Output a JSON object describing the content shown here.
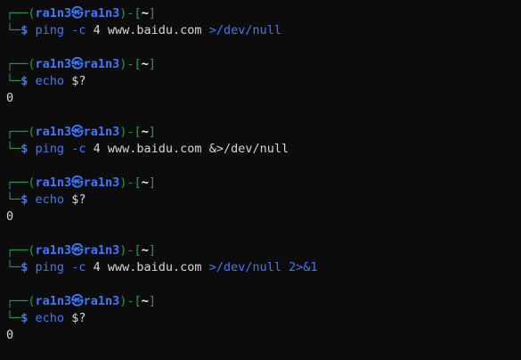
{
  "terminal": {
    "user": "ra1n3",
    "host": "ra1n3",
    "separator": "㉿",
    "cwd": "~",
    "prompt_symbol": "$",
    "frame_top": "┌──(",
    "frame_mid": ")-[",
    "frame_end": "]",
    "frame_bottom": "└─",
    "entries": [
      {
        "cmd": "ping",
        "flag": "-c",
        "count": "4",
        "host": "www.baidu.com",
        "redirect": ">/dev/null",
        "extra": ""
      },
      {
        "cmd": "echo",
        "arg": "$?",
        "output": "0"
      },
      {
        "cmd": "ping",
        "flag": "-c",
        "count": "4",
        "host": "www.baidu.com",
        "redirect": "&>/dev/null",
        "extra": ""
      },
      {
        "cmd": "echo",
        "arg": "$?",
        "output": "0"
      },
      {
        "cmd": "ping",
        "flag": "-c",
        "count": "4",
        "host": "www.baidu.com",
        "redirect": ">/dev/null",
        "extra_redir": "2>",
        "extra_fd": "&1"
      },
      {
        "cmd": "echo",
        "arg": "$?",
        "output": "0"
      }
    ]
  },
  "colors": {
    "background": "#0c0c0c",
    "frame": "#1e9c4d",
    "accent_blue": "#3b78ff",
    "text": "#d6d6d6"
  }
}
